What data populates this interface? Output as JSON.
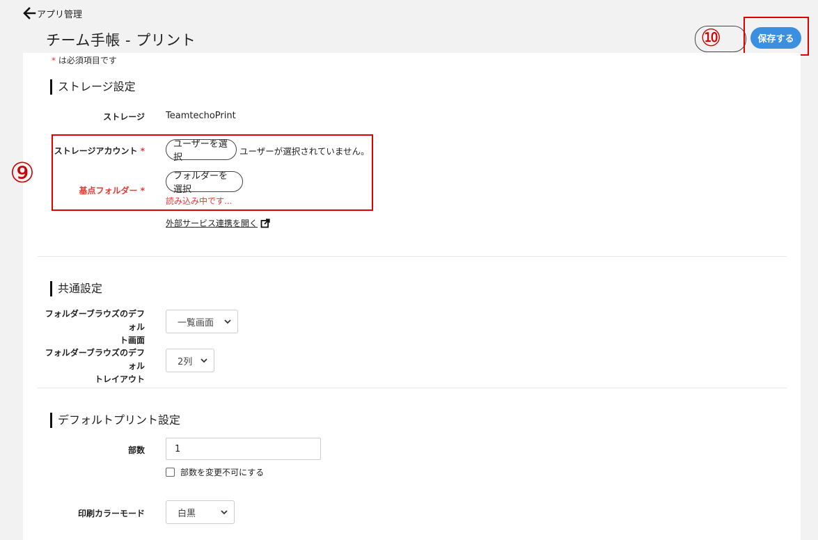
{
  "header": {
    "back_label": "アプリ管理",
    "title": "チーム手帳 - プリント",
    "save_label": "保存する",
    "annotation_10": "⑩"
  },
  "form": {
    "required_note": "は必須項目です",
    "required_mark": "*"
  },
  "storage": {
    "section_title": "ストレージ設定",
    "storage_label": "ストレージ",
    "storage_value": "TeamtechoPrint",
    "account_label": "ストレージアカウント",
    "account_button": "ユーザーを選択",
    "account_status": "ユーザーが選択されていません。",
    "folder_label": "基点フォルダー",
    "folder_button": "フォルダーを選択",
    "folder_status": "読み込み中です...",
    "external_link": "外部サービス連携を開く",
    "annotation_9": "⑨"
  },
  "common": {
    "section_title": "共通設定",
    "browse_screen_label_1": "フォルダーブラウズのデフォル",
    "browse_screen_label_2": "ト画面",
    "browse_screen_value": "一覧画面",
    "browse_layout_label_1": "フォルダーブラウズのデフォル",
    "browse_layout_label_2": "トレイアウト",
    "browse_layout_value": "2列"
  },
  "print": {
    "section_title": "デフォルトプリント設定",
    "copies_label": "部数",
    "copies_value": "1",
    "copies_lock_label": "部数を変更不可にする",
    "color_label": "印刷カラーモード",
    "color_value": "白黒"
  },
  "colors": {
    "accent": "#3b8fe0",
    "required": "#e53935",
    "annotation": "#e00000"
  }
}
